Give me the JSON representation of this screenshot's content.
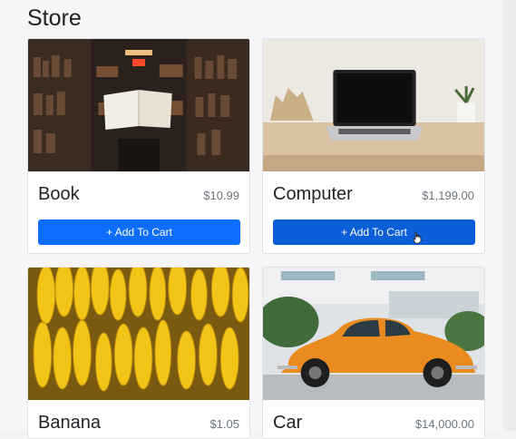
{
  "page": {
    "title": "Store"
  },
  "products": [
    {
      "name": "Book",
      "price": "$10.99",
      "button": "+ Add To Cart",
      "image": "bookshelf-library-photo"
    },
    {
      "name": "Computer",
      "price": "$1,199.00",
      "button": "+ Add To Cart",
      "image": "laptop-on-desk-photo"
    },
    {
      "name": "Banana",
      "price": "$1.05",
      "image": "banana-bunches-photo"
    },
    {
      "name": "Car",
      "price": "$14,000.00",
      "image": "orange-beetle-car-photo"
    }
  ],
  "colors": {
    "primary": "#0d6efd",
    "primary_hover": "#0b5ed7",
    "price_text": "#6c757d"
  }
}
